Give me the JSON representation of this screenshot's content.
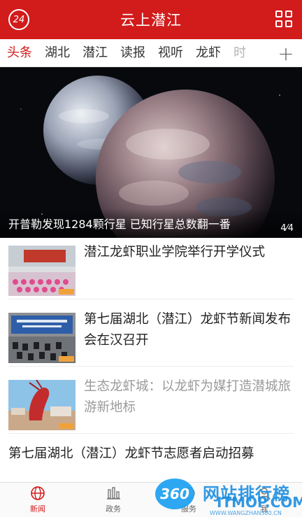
{
  "header": {
    "title": "云上潜江",
    "badge_text": "24",
    "menu_icon": "grid-menu-icon",
    "color": "#d21b1b"
  },
  "tabs": [
    {
      "label": "头条",
      "active": true
    },
    {
      "label": "湖北"
    },
    {
      "label": "潜江"
    },
    {
      "label": "读报"
    },
    {
      "label": "视听"
    },
    {
      "label": "龙虾"
    },
    {
      "label": "时",
      "faded": true
    }
  ],
  "tabs_add": "+",
  "hero": {
    "caption": "开普勒发现1284颗行星 已知行星总数翻一番",
    "pager": "4⁄4"
  },
  "news": [
    {
      "headline": "潜江龙虾职业学院举行开学仪式",
      "read": false
    },
    {
      "headline": "第七届湖北（潜江）龙虾节新闻发布会在汉召开",
      "read": false
    },
    {
      "headline": "生态龙虾城：以龙虾为媒打造潜城旅游新地标",
      "read": true
    }
  ],
  "text_only_headline": "第七届湖北（潜江）龙虾节志愿者启动招募",
  "bottom_nav": [
    {
      "label": "新闻",
      "icon": "globe-icon",
      "active": true
    },
    {
      "label": "政务",
      "icon": "bar-chart-icon"
    },
    {
      "label": "服务",
      "icon": "service-icon"
    },
    {
      "label": "我",
      "icon": "user-icon"
    }
  ],
  "watermark": {
    "badge": "360",
    "title": "网站排行榜",
    "brand": "ITMOP.COM",
    "url": "WWW.WANGZHAN360.CN"
  }
}
